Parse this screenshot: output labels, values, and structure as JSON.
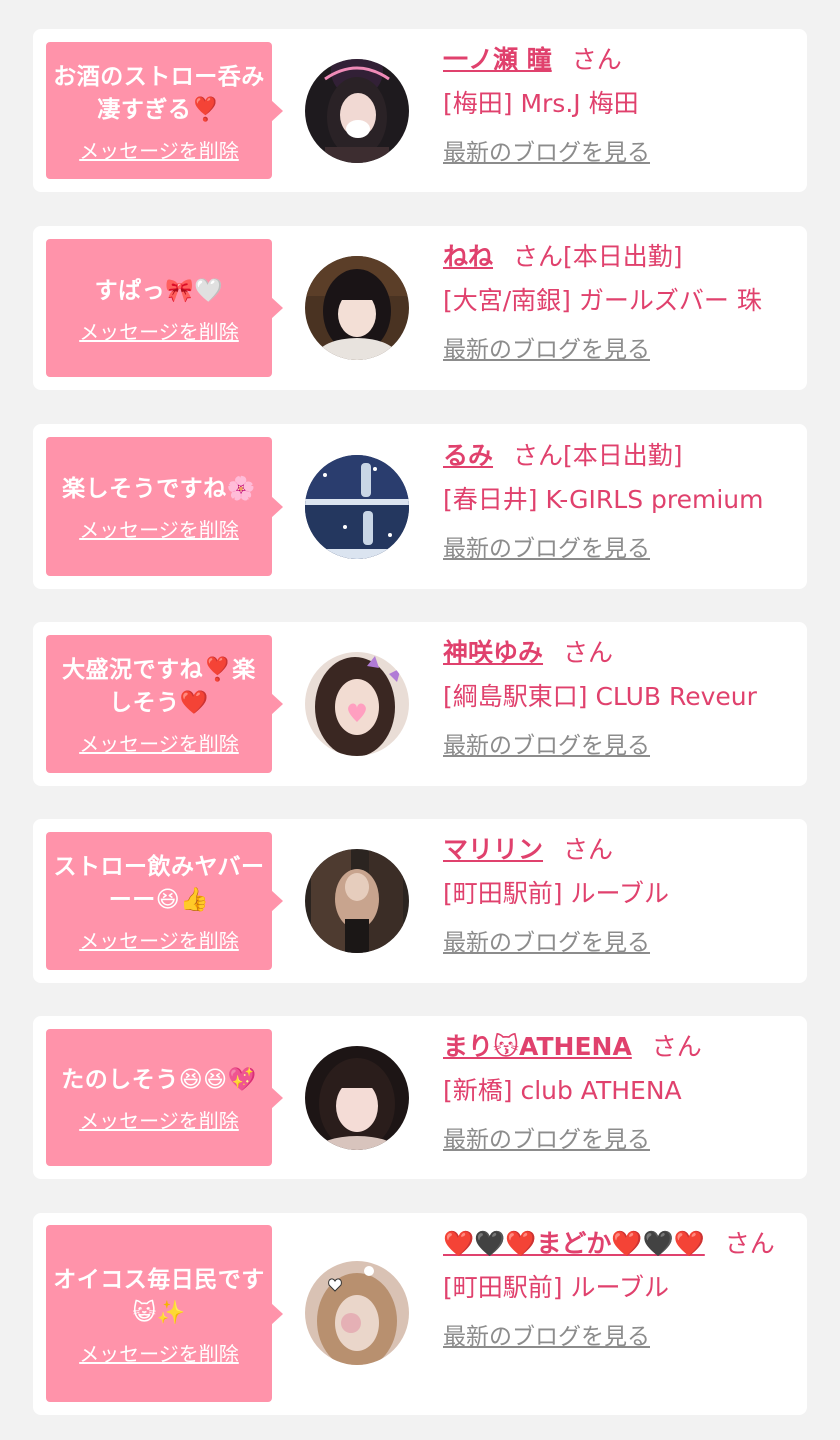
{
  "items": [
    {
      "message": "お酒のストロー呑み凄すぎる❣️",
      "delete_label": "メッセージを削除",
      "name": "一ノ瀬 瞳",
      "honorific": "さん",
      "badge": "",
      "shop": "[梅田] Mrs.J 梅田",
      "blog_link": "最新のブログを見る"
    },
    {
      "message": "すぱっ🎀🤍",
      "delete_label": "メッセージを削除",
      "name": "ねね",
      "honorific": "さん",
      "badge": "[本日出勤]",
      "shop": "[大宮/南銀] ガールズバー 珠",
      "blog_link": "最新のブログを見る"
    },
    {
      "message": "楽しそうですね🌸",
      "delete_label": "メッセージを削除",
      "name": "るみ",
      "honorific": "さん",
      "badge": "[本日出勤]",
      "shop": "[春日井] K-GIRLS premium",
      "blog_link": "最新のブログを見る"
    },
    {
      "message": "大盛況ですね❣️楽しそう❤️",
      "delete_label": "メッセージを削除",
      "name": "神咲ゆみ",
      "honorific": "さん",
      "badge": "",
      "shop": "[綱島駅東口] CLUB Reveur",
      "blog_link": "最新のブログを見る"
    },
    {
      "message": "ストロー飲みヤバーーー😆👍",
      "delete_label": "メッセージを削除",
      "name": "マリリン",
      "honorific": "さん",
      "badge": "",
      "shop": "[町田駅前] ルーブル",
      "blog_link": "最新のブログを見る"
    },
    {
      "message": "たのしそう😆😆💖",
      "delete_label": "メッセージを削除",
      "name": "まり😽ATHENA",
      "honorific": "さん",
      "badge": "",
      "shop": "[新橋] club ATHENA",
      "blog_link": "最新のブログを見る"
    },
    {
      "message": "オイコス毎日民です😺✨",
      "delete_label": "メッセージを削除",
      "name": "❤️🖤❤️まどか❤️🖤❤️",
      "honorific": "さん",
      "badge": "",
      "shop": "[町田駅前] ルーブル",
      "blog_link": "最新のブログを見る"
    }
  ]
}
